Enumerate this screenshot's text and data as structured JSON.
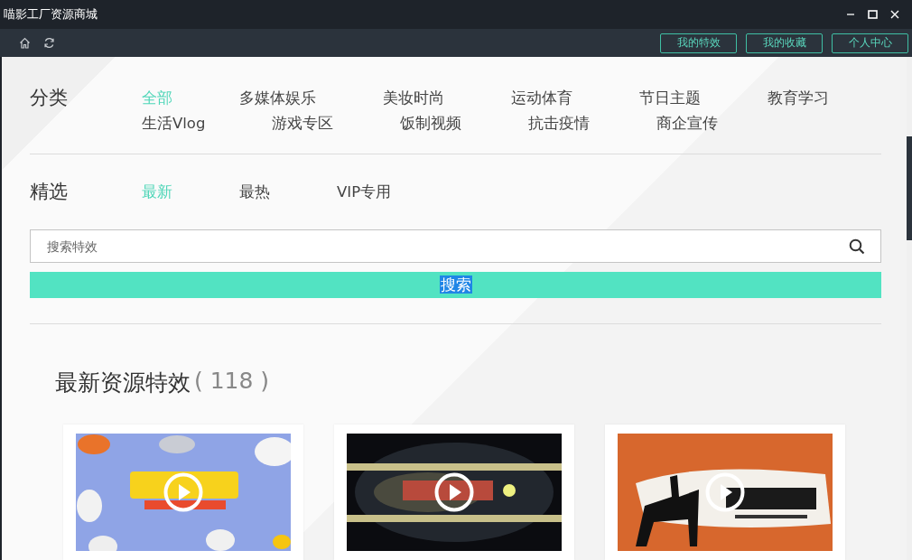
{
  "window": {
    "title": "喵影工厂资源商城"
  },
  "toolbar": {
    "buttons": [
      "我的特效",
      "我的收藏",
      "个人中心"
    ]
  },
  "categories": {
    "label": "分类",
    "items": [
      {
        "label": "全部",
        "selected": true
      },
      {
        "label": "多媒体娱乐",
        "selected": false
      },
      {
        "label": "美妆时尚",
        "selected": false
      },
      {
        "label": "运动体育",
        "selected": false
      },
      {
        "label": "节日主题",
        "selected": false
      },
      {
        "label": "教育学习",
        "selected": false
      },
      {
        "label": "生活Vlog",
        "selected": false
      },
      {
        "label": "游戏专区",
        "selected": false
      },
      {
        "label": "饭制视频",
        "selected": false
      },
      {
        "label": "抗击疫情",
        "selected": false
      },
      {
        "label": "商企宣传",
        "selected": false
      }
    ]
  },
  "featured": {
    "label": "精选",
    "items": [
      {
        "label": "最新",
        "selected": true
      },
      {
        "label": "最热",
        "selected": false
      },
      {
        "label": "VIP专用",
        "selected": false
      }
    ]
  },
  "search": {
    "placeholder": "搜索特效",
    "button": "搜索"
  },
  "section": {
    "title": "最新资源特效",
    "count": "( 118 )"
  },
  "cards": [
    {
      "kind": "video"
    },
    {
      "kind": "video"
    },
    {
      "kind": "video"
    }
  ]
}
